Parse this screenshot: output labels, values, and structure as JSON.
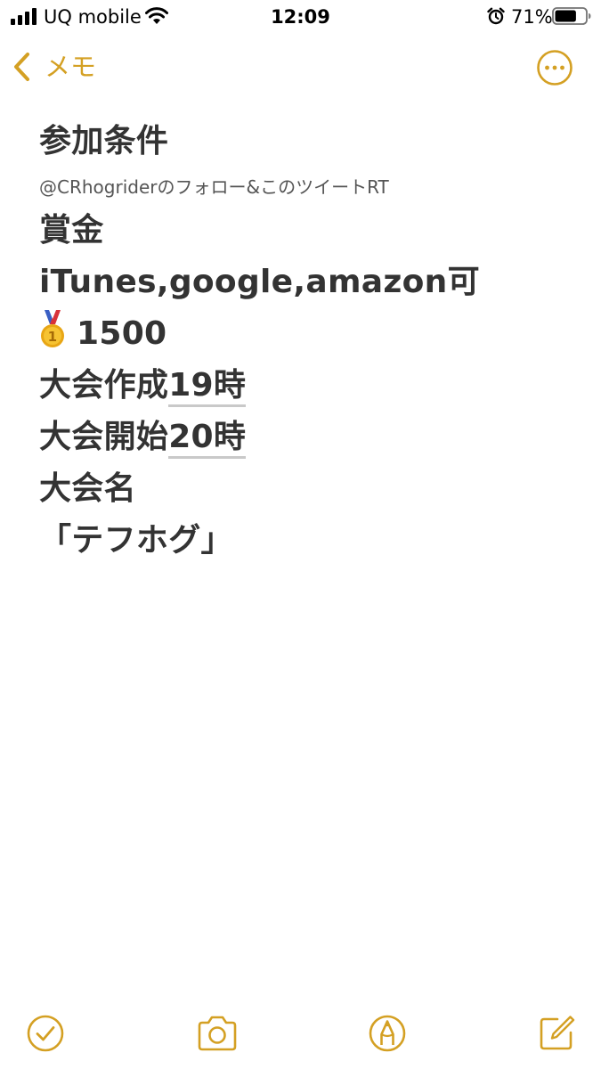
{
  "status_bar": {
    "carrier": "UQ mobile",
    "time": "12:09",
    "battery_percent": "71%",
    "battery_level": 0.71,
    "icons": [
      "signal-icon",
      "wifi-icon",
      "alarm-icon",
      "battery-icon"
    ]
  },
  "nav": {
    "back_label": "メモ",
    "back_icon": "chevron-left-icon",
    "more_icon": "ellipsis-circle-icon"
  },
  "note": {
    "title": "参加条件",
    "condition": "@CRhogriderのフォロー&このツイートRT",
    "prize_heading": "賞金",
    "prize_types": "iTunes,google,amazon可",
    "prize_medal_icon": "gold-medal-icon",
    "prize_amount": "1500",
    "create_label": "大会作成",
    "create_time": "19時",
    "start_label": "大会開始",
    "start_time": "20時",
    "name_heading": "大会名",
    "name_value": "「テフホグ」"
  },
  "toolbar": {
    "icons": [
      "checklist-icon",
      "camera-icon",
      "markup-icon",
      "compose-icon"
    ]
  },
  "colors": {
    "accent": "#d4a023",
    "text": "#333333",
    "secondary_text": "#555555",
    "background": "#ffffff"
  }
}
